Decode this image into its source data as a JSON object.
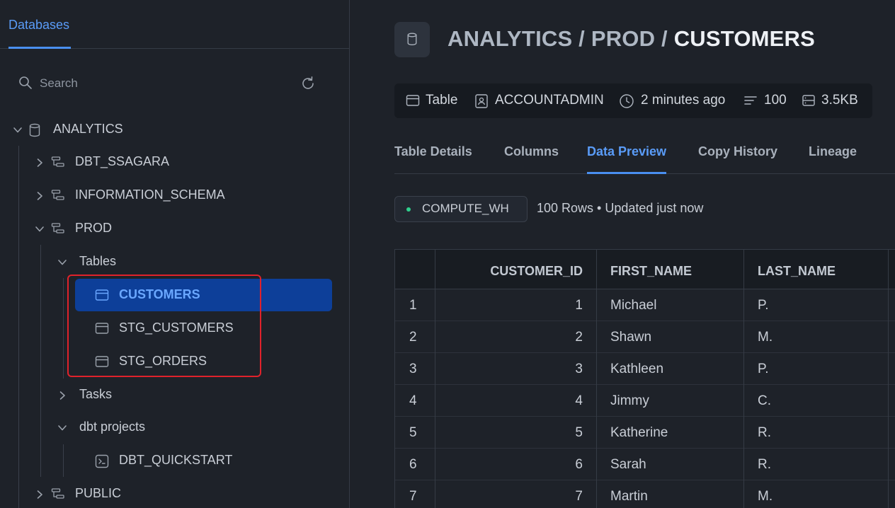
{
  "sidebar": {
    "tab_label": "Databases",
    "search_placeholder": "Search",
    "tree": {
      "database": "ANALYTICS",
      "schemas": [
        "DBT_SSAGARA",
        "INFORMATION_SCHEMA",
        "PROD",
        "PUBLIC"
      ],
      "prod_groups": {
        "tables_label": "Tables",
        "tables": [
          "CUSTOMERS",
          "STG_CUSTOMERS",
          "STG_ORDERS"
        ],
        "tasks_label": "Tasks",
        "dbt_projects_label": "dbt projects",
        "dbt_projects": [
          "DBT_QUICKSTART"
        ]
      },
      "selected_table": "CUSTOMERS"
    }
  },
  "header": {
    "crumb_db": "ANALYTICS",
    "crumb_schema": "PROD",
    "crumb_table": "CUSTOMERS",
    "separator": "/"
  },
  "meta": {
    "type": "Table",
    "owner": "ACCOUNTADMIN",
    "updated": "2 minutes ago",
    "rows": "100",
    "size": "3.5KB"
  },
  "tabs": [
    "Table Details",
    "Columns",
    "Data Preview",
    "Copy History",
    "Lineage"
  ],
  "active_tab": "Data Preview",
  "preview": {
    "warehouse": "COMPUTE_WH",
    "summary": "100 Rows • Updated just now",
    "columns": [
      "CUSTOMER_ID",
      "FIRST_NAME",
      "LAST_NAME"
    ],
    "rows": [
      {
        "n": "1",
        "id": "1",
        "first": "Michael",
        "last": "P."
      },
      {
        "n": "2",
        "id": "2",
        "first": "Shawn",
        "last": "M."
      },
      {
        "n": "3",
        "id": "3",
        "first": "Kathleen",
        "last": "P."
      },
      {
        "n": "4",
        "id": "4",
        "first": "Jimmy",
        "last": "C."
      },
      {
        "n": "5",
        "id": "5",
        "first": "Katherine",
        "last": "R."
      },
      {
        "n": "6",
        "id": "6",
        "first": "Sarah",
        "last": "R."
      },
      {
        "n": "7",
        "id": "7",
        "first": "Martin",
        "last": "M."
      }
    ]
  },
  "colors": {
    "accent": "#5a9cf8",
    "selected": "#0d3f99",
    "highlight": "#e0222b",
    "status_dot": "#2fd08d"
  }
}
